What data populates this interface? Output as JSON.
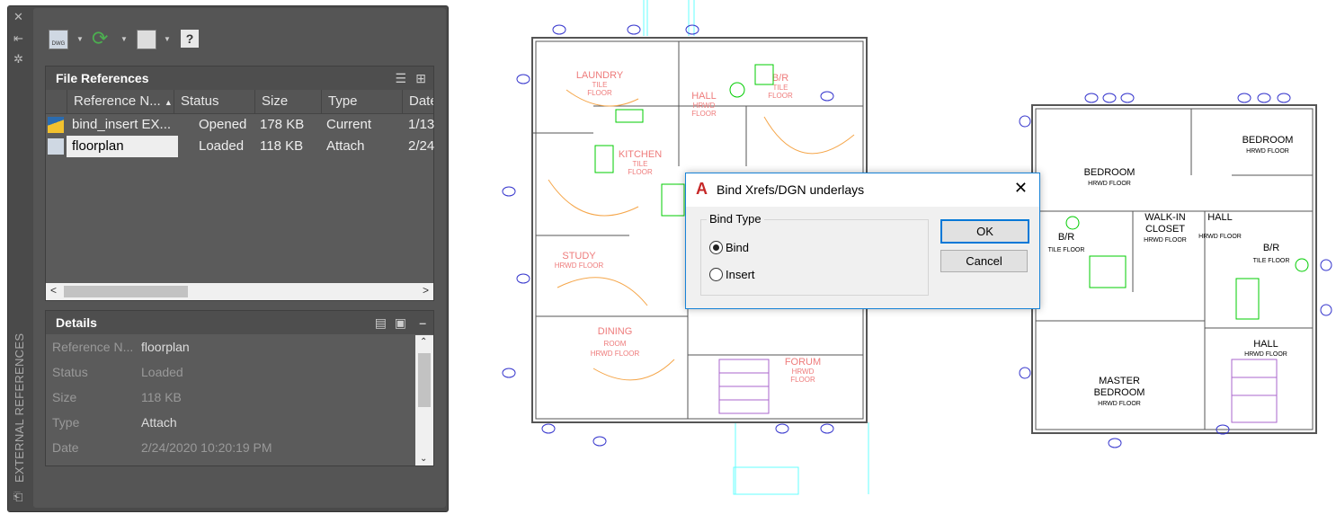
{
  "palette": {
    "side_label": "EXTERNAL REFERENCES",
    "toolbar": {
      "attach": "attach-dwg-icon",
      "refresh": "refresh-icon",
      "change_path": "change-path-icon",
      "help": "help-icon"
    },
    "file_references": {
      "title": "File References",
      "columns": [
        "Reference N...",
        "Status",
        "Size",
        "Type",
        "Date"
      ],
      "rows": [
        {
          "name": "bind_insert EX...",
          "status": "Opened",
          "size": "178 KB",
          "type": "Current",
          "date": "1/13"
        },
        {
          "name": "floorplan",
          "status": "Loaded",
          "size": "118 KB",
          "type": "Attach",
          "date": "2/24"
        }
      ]
    },
    "details": {
      "title": "Details",
      "fields": [
        {
          "key": "Reference N...",
          "value": "floorplan"
        },
        {
          "key": "Status",
          "value": "Loaded"
        },
        {
          "key": "Size",
          "value": "118 KB"
        },
        {
          "key": "Type",
          "value": "Attach"
        },
        {
          "key": "Date",
          "value": "2/24/2020 10:20:19 PM"
        }
      ]
    }
  },
  "dialog": {
    "title": "Bind Xrefs/DGN underlays",
    "group": "Bind Type",
    "options": [
      {
        "label": "Bind",
        "selected": true
      },
      {
        "label": "Insert",
        "selected": false
      }
    ],
    "ok": "OK",
    "cancel": "Cancel"
  },
  "plan1": {
    "rooms": [
      {
        "name": "LAUNDRY",
        "sub1": "TILE",
        "sub2": "FLOOR"
      },
      {
        "name": "HALL",
        "sub1": "HRWD",
        "sub2": "FLOOR"
      },
      {
        "name": "B/R",
        "sub1": "TILE",
        "sub2": "FLOOR"
      },
      {
        "name": "KITCHEN",
        "sub1": "TILE",
        "sub2": "FLOOR"
      },
      {
        "name": "STUDY",
        "sub1": "HRWD FLOOR",
        "sub2": ""
      },
      {
        "name": "DINING",
        "sub1": "ROOM",
        "sub2": "HRWD FLOOR"
      },
      {
        "name": "FORUM",
        "sub1": "HRWD",
        "sub2": "FLOOR"
      }
    ]
  },
  "plan2": {
    "rooms": [
      {
        "name": "BEDROOM",
        "sub": "HRWD FLOOR"
      },
      {
        "name": "BEDROOM",
        "sub": "HRWD FLOOR"
      },
      {
        "name": "WALK-IN",
        "name2": "CLOSET",
        "sub": "HRWD FLOOR"
      },
      {
        "name": "HALL",
        "sub": "HRWD FLOOR"
      },
      {
        "name": "B/R",
        "sub": "TILE FLOOR"
      },
      {
        "name": "B/R",
        "sub": "TILE FLOOR"
      },
      {
        "name": "MASTER",
        "name2": "BEDROOM",
        "sub": "HRWD FLOOR"
      },
      {
        "name": "HALL",
        "sub": "HRWD FLOOR"
      }
    ]
  }
}
